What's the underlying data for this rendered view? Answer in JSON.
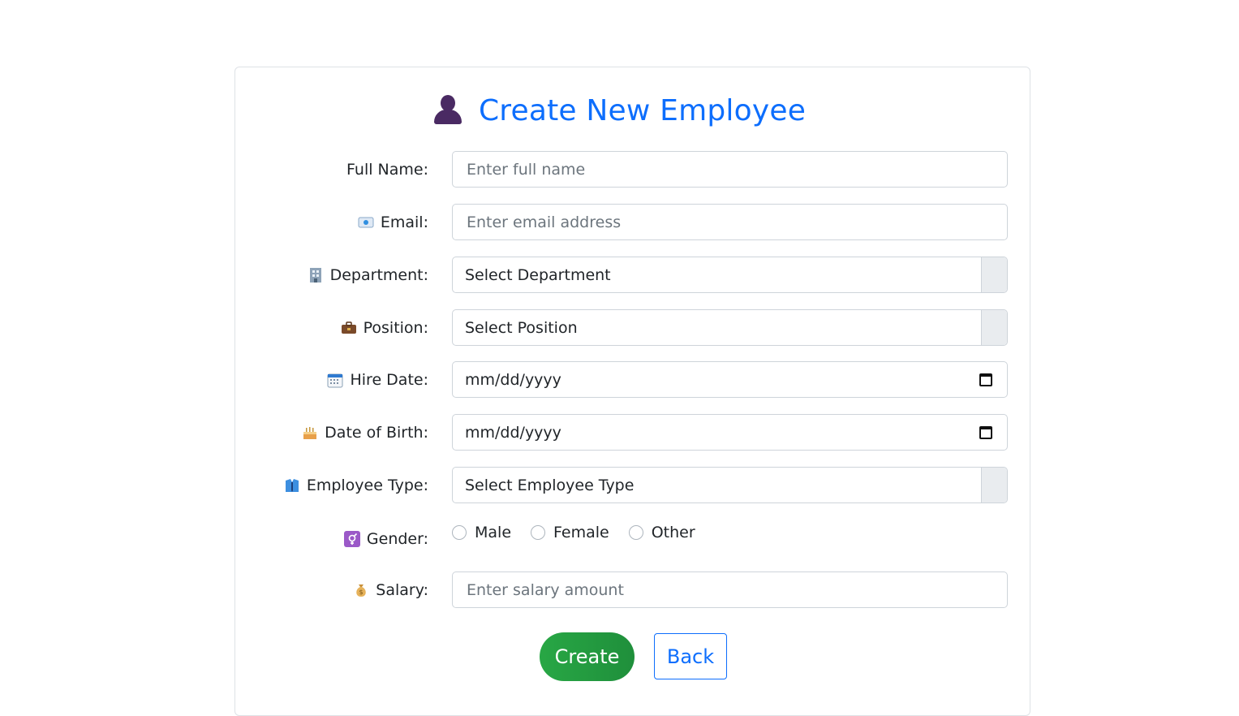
{
  "form": {
    "title": "Create New Employee",
    "title_icon": "person-icon",
    "accent_color": "#0d6efd",
    "create_color": "#28a745"
  },
  "fields": {
    "full_name": {
      "label": "Full Name:",
      "placeholder": "Enter full name"
    },
    "email": {
      "label": "Email:",
      "icon": "email-icon",
      "placeholder": "Enter email address"
    },
    "department": {
      "label": "Department:",
      "icon": "building-icon",
      "value": "Select Department"
    },
    "position": {
      "label": "Position:",
      "icon": "briefcase-icon",
      "value": "Select Position"
    },
    "hire_date": {
      "label": "Hire Date:",
      "icon": "calendar-icon",
      "value": "mm/dd/yyyy"
    },
    "dob": {
      "label": "Date of Birth:",
      "icon": "cake-icon",
      "value": "mm/dd/yyyy"
    },
    "employee_type": {
      "label": "Employee Type:",
      "icon": "suit-icon",
      "value": "Select Employee Type"
    },
    "gender": {
      "label": "Gender:",
      "icon": "gender-icon",
      "options": [
        "Male",
        "Female",
        "Other"
      ]
    },
    "salary": {
      "label": "Salary:",
      "icon": "money-bag-icon",
      "placeholder": "Enter salary amount"
    }
  },
  "buttons": {
    "create": "Create",
    "back": "Back"
  }
}
